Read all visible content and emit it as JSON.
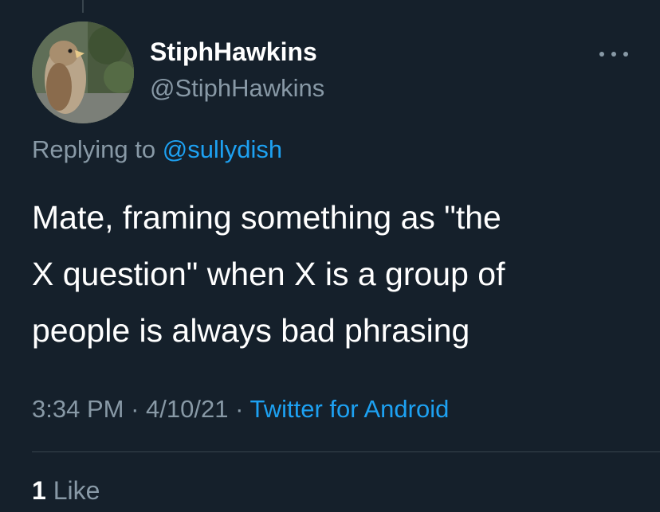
{
  "tweet": {
    "author": {
      "display_name": "StiphHawkins",
      "handle": "@StiphHawkins",
      "avatar_icon": "hawk-avatar"
    },
    "more_icon": "ellipsis-icon",
    "replying_prefix": "Replying to",
    "replying_to": "@sullydish",
    "text_lines": [
      "Mate, framing something as \"the",
      "X question\" when X is a group of",
      "people is always bad phrasing"
    ],
    "time": "3:34 PM",
    "separator": "·",
    "date": "4/10/21",
    "source": "Twitter for Android",
    "likes": {
      "count": "1",
      "label": "Like"
    }
  },
  "colors": {
    "background": "#15202b",
    "text": "#ffffff",
    "secondary": "#8899a6",
    "accent": "#1da1f2",
    "divider": "#38444d"
  }
}
